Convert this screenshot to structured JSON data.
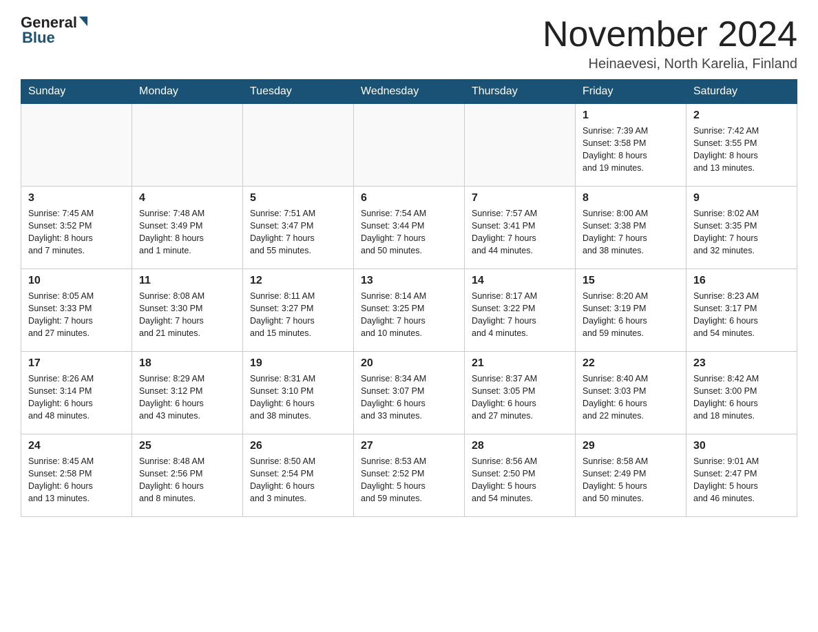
{
  "header": {
    "logo_general": "General",
    "logo_blue": "Blue",
    "month_title": "November 2024",
    "location": "Heinaevesi, North Karelia, Finland"
  },
  "days_of_week": [
    "Sunday",
    "Monday",
    "Tuesday",
    "Wednesday",
    "Thursday",
    "Friday",
    "Saturday"
  ],
  "weeks": [
    [
      {
        "num": "",
        "info": ""
      },
      {
        "num": "",
        "info": ""
      },
      {
        "num": "",
        "info": ""
      },
      {
        "num": "",
        "info": ""
      },
      {
        "num": "",
        "info": ""
      },
      {
        "num": "1",
        "info": "Sunrise: 7:39 AM\nSunset: 3:58 PM\nDaylight: 8 hours\nand 19 minutes."
      },
      {
        "num": "2",
        "info": "Sunrise: 7:42 AM\nSunset: 3:55 PM\nDaylight: 8 hours\nand 13 minutes."
      }
    ],
    [
      {
        "num": "3",
        "info": "Sunrise: 7:45 AM\nSunset: 3:52 PM\nDaylight: 8 hours\nand 7 minutes."
      },
      {
        "num": "4",
        "info": "Sunrise: 7:48 AM\nSunset: 3:49 PM\nDaylight: 8 hours\nand 1 minute."
      },
      {
        "num": "5",
        "info": "Sunrise: 7:51 AM\nSunset: 3:47 PM\nDaylight: 7 hours\nand 55 minutes."
      },
      {
        "num": "6",
        "info": "Sunrise: 7:54 AM\nSunset: 3:44 PM\nDaylight: 7 hours\nand 50 minutes."
      },
      {
        "num": "7",
        "info": "Sunrise: 7:57 AM\nSunset: 3:41 PM\nDaylight: 7 hours\nand 44 minutes."
      },
      {
        "num": "8",
        "info": "Sunrise: 8:00 AM\nSunset: 3:38 PM\nDaylight: 7 hours\nand 38 minutes."
      },
      {
        "num": "9",
        "info": "Sunrise: 8:02 AM\nSunset: 3:35 PM\nDaylight: 7 hours\nand 32 minutes."
      }
    ],
    [
      {
        "num": "10",
        "info": "Sunrise: 8:05 AM\nSunset: 3:33 PM\nDaylight: 7 hours\nand 27 minutes."
      },
      {
        "num": "11",
        "info": "Sunrise: 8:08 AM\nSunset: 3:30 PM\nDaylight: 7 hours\nand 21 minutes."
      },
      {
        "num": "12",
        "info": "Sunrise: 8:11 AM\nSunset: 3:27 PM\nDaylight: 7 hours\nand 15 minutes."
      },
      {
        "num": "13",
        "info": "Sunrise: 8:14 AM\nSunset: 3:25 PM\nDaylight: 7 hours\nand 10 minutes."
      },
      {
        "num": "14",
        "info": "Sunrise: 8:17 AM\nSunset: 3:22 PM\nDaylight: 7 hours\nand 4 minutes."
      },
      {
        "num": "15",
        "info": "Sunrise: 8:20 AM\nSunset: 3:19 PM\nDaylight: 6 hours\nand 59 minutes."
      },
      {
        "num": "16",
        "info": "Sunrise: 8:23 AM\nSunset: 3:17 PM\nDaylight: 6 hours\nand 54 minutes."
      }
    ],
    [
      {
        "num": "17",
        "info": "Sunrise: 8:26 AM\nSunset: 3:14 PM\nDaylight: 6 hours\nand 48 minutes."
      },
      {
        "num": "18",
        "info": "Sunrise: 8:29 AM\nSunset: 3:12 PM\nDaylight: 6 hours\nand 43 minutes."
      },
      {
        "num": "19",
        "info": "Sunrise: 8:31 AM\nSunset: 3:10 PM\nDaylight: 6 hours\nand 38 minutes."
      },
      {
        "num": "20",
        "info": "Sunrise: 8:34 AM\nSunset: 3:07 PM\nDaylight: 6 hours\nand 33 minutes."
      },
      {
        "num": "21",
        "info": "Sunrise: 8:37 AM\nSunset: 3:05 PM\nDaylight: 6 hours\nand 27 minutes."
      },
      {
        "num": "22",
        "info": "Sunrise: 8:40 AM\nSunset: 3:03 PM\nDaylight: 6 hours\nand 22 minutes."
      },
      {
        "num": "23",
        "info": "Sunrise: 8:42 AM\nSunset: 3:00 PM\nDaylight: 6 hours\nand 18 minutes."
      }
    ],
    [
      {
        "num": "24",
        "info": "Sunrise: 8:45 AM\nSunset: 2:58 PM\nDaylight: 6 hours\nand 13 minutes."
      },
      {
        "num": "25",
        "info": "Sunrise: 8:48 AM\nSunset: 2:56 PM\nDaylight: 6 hours\nand 8 minutes."
      },
      {
        "num": "26",
        "info": "Sunrise: 8:50 AM\nSunset: 2:54 PM\nDaylight: 6 hours\nand 3 minutes."
      },
      {
        "num": "27",
        "info": "Sunrise: 8:53 AM\nSunset: 2:52 PM\nDaylight: 5 hours\nand 59 minutes."
      },
      {
        "num": "28",
        "info": "Sunrise: 8:56 AM\nSunset: 2:50 PM\nDaylight: 5 hours\nand 54 minutes."
      },
      {
        "num": "29",
        "info": "Sunrise: 8:58 AM\nSunset: 2:49 PM\nDaylight: 5 hours\nand 50 minutes."
      },
      {
        "num": "30",
        "info": "Sunrise: 9:01 AM\nSunset: 2:47 PM\nDaylight: 5 hours\nand 46 minutes."
      }
    ]
  ]
}
